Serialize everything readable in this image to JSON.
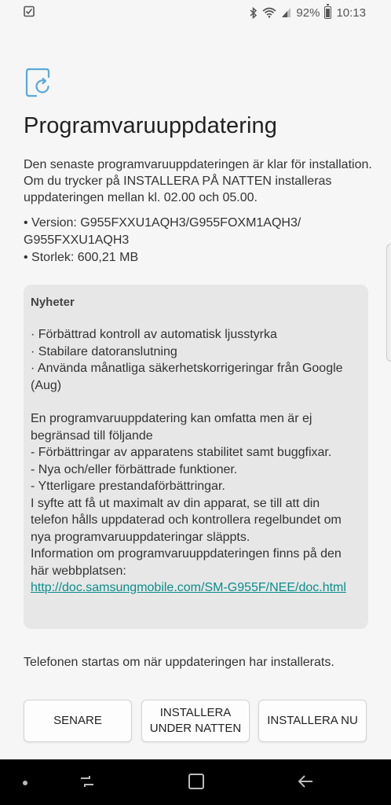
{
  "status_bar": {
    "battery_percent": "92%",
    "time": "10:13",
    "icons": [
      "checklist-icon",
      "bluetooth-icon",
      "wifi-icon",
      "signal-icon",
      "battery-icon"
    ]
  },
  "page": {
    "title": "Programvaruuppdatering",
    "intro": "Den senaste programvaruuppdateringen är klar för installation. Om du trycker på INSTALLERA PÅ NATTEN installeras uppdateringen mellan kl. 02.00 och 05.00.",
    "version_line": "• Version: G955FXXU1AQH3/G955FOXM1AQH3/ G955FXXU1AQH3",
    "size_line": "• Storlek: 600,21 MB"
  },
  "news": {
    "title": "Nyheter",
    "items": [
      "· Förbättrad kontroll av automatisk ljusstyrka",
      "· Stabilare datoranslutning",
      "· Använda månatliga säkerhetskorrigeringar från Google (Aug)"
    ],
    "body": "En programvaruuppdatering kan omfatta men är ej begränsad till följande\n - Förbättringar av apparatens stabilitet samt buggfixar.\n - Nya och/eller förbättrade funktioner.\n - Ytterligare prestandaförbättringar.\nI syfte att få ut maximalt av din apparat, se till att din telefon hålls uppdaterad och kontrollera regelbundet om nya programvaruuppdateringar släppts.\nInformation om programvaruuppdateringen finns på den här webbplatsen:",
    "link": "http://doc.samsungmobile.com/SM-G955F/NEE/doc.html"
  },
  "restart_note": "Telefonen startas om när uppdateringen har installerats.",
  "buttons": {
    "later": "SENARE",
    "night": "INSTALLERA UNDER NATTEN",
    "now": "INSTALLERA NU"
  },
  "colors": {
    "background": "#f6f6f6",
    "card": "#e7e7e7",
    "accent_icon": "#5aa9d8",
    "link": "#0a8e8b",
    "nav_bar": "#000000"
  }
}
